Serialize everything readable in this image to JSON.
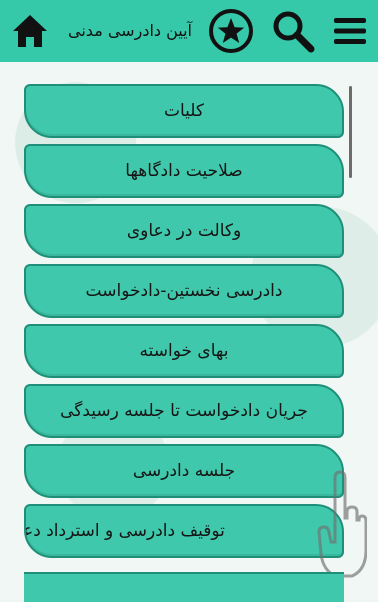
{
  "app": {
    "title": "آیین دادرسی مدنی"
  },
  "toolbar": {
    "home_icon": "home-icon",
    "favorite_icon": "star-icon",
    "search_icon": "search-icon",
    "menu_icon": "hamburger-menu-icon",
    "background_color": "#36c9a9"
  },
  "list": {
    "items": [
      {
        "label": "کلیات"
      },
      {
        "label": "صلاحیت دادگاهها"
      },
      {
        "label": "وکالت در دعاوی"
      },
      {
        "label": "دادرسی نخستین-دادخواست"
      },
      {
        "label": "بهای خواسته"
      },
      {
        "label": "جریان دادخواست تا جلسه رسیدگی"
      },
      {
        "label": "جلسه دادرسی"
      },
      {
        "label": "توقیف دادرسی و استرداد دعوا و"
      }
    ],
    "item_color": "#3fc8ab",
    "item_border_color": "#1f8f79"
  }
}
